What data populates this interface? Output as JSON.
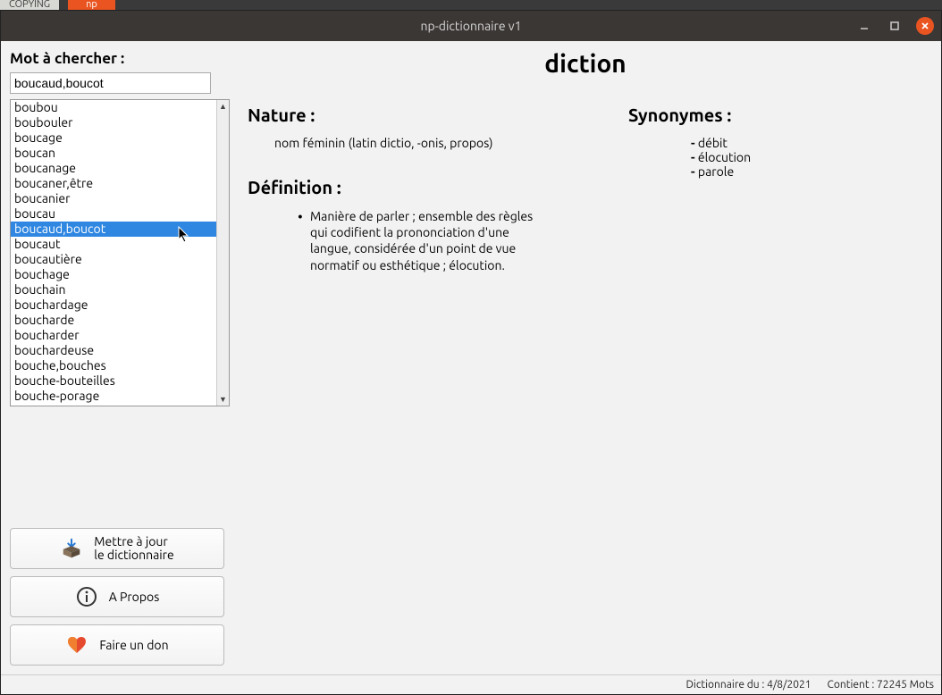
{
  "backdrop": {
    "tab1": "COPYING",
    "tab2": "np"
  },
  "window": {
    "title": "np-dictionnaire v1"
  },
  "search": {
    "label": "Mot à chercher :",
    "value": "boucaud,boucot",
    "suggestions": [
      "boubou",
      "boubouler",
      "boucage",
      "boucan",
      "boucanage",
      "boucaner,être",
      "boucanier",
      "boucau",
      "boucaud,boucot",
      "boucaut",
      "boucautière",
      "bouchage",
      "bouchain",
      "bouchardage",
      "boucharde",
      "boucharder",
      "bouchardeuse",
      "bouche,bouches",
      "bouche-bouteilles",
      "bouche-porage"
    ],
    "selected_index": 8
  },
  "entry": {
    "headword": "diction",
    "nature_label": "Nature :",
    "nature_text": "nom féminin (latin dictio, -onis, propos)",
    "definition_label": "Définition :",
    "definitions": [
      "Manière de parler ; ensemble des règles qui codifient la prononciation d'une langue, considérée d'un point de vue normatif ou esthétique ; élocution."
    ],
    "synonyms_label": "Synonymes :",
    "synonyms": [
      "débit",
      "élocution",
      "parole"
    ]
  },
  "buttons": {
    "update_line1": "Mettre à jour",
    "update_line2": "le dictionnaire",
    "about": "A Propos",
    "donate": "Faire un don"
  },
  "status": {
    "dict_date_label": "Dictionnaire du :",
    "dict_date": "4/8/2021",
    "word_count_label": "Contient :",
    "word_count": "72245 Mots"
  }
}
